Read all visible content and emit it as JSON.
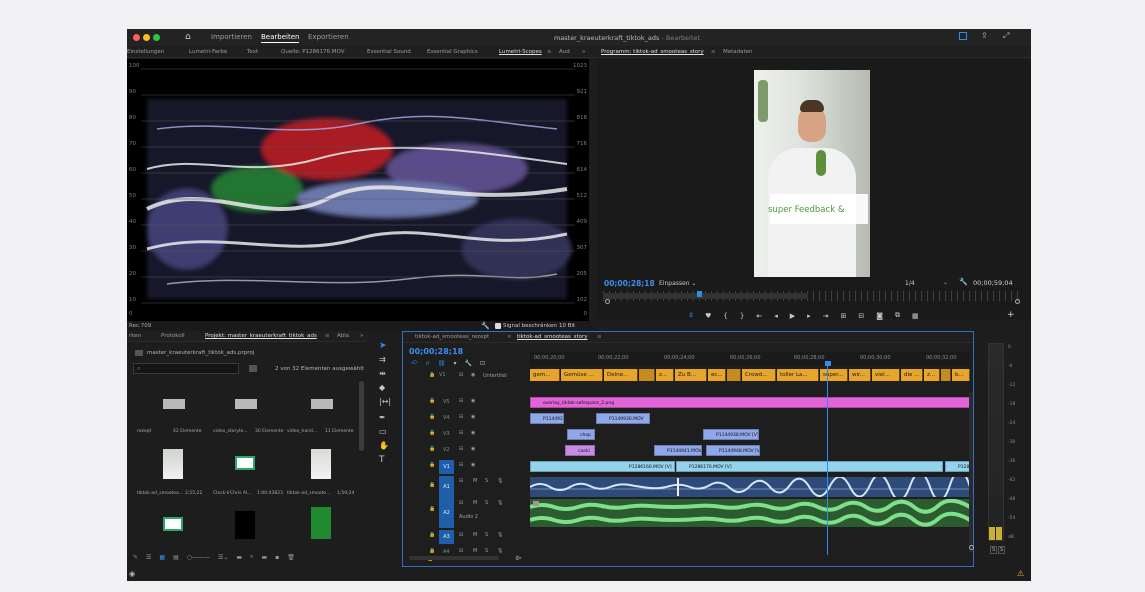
{
  "window": {
    "title": "master_kraeuterkraft_tiktok_ads",
    "title_suffix": " - Bearbeitet",
    "nav": [
      "Importieren",
      "Bearbeiten",
      "Exportieren"
    ]
  },
  "panel_tabs": [
    "Einstellungen",
    "Lumetri-Farbe",
    "Text",
    "Quelle: P1286176.MOV",
    "Essential Sound",
    "Essential Graphics",
    "Lumetri-Scopes",
    "Aud"
  ],
  "scopes": {
    "left_scale": [
      "100",
      "90",
      "80",
      "70",
      "60",
      "50",
      "40",
      "30",
      "20",
      "10",
      "0"
    ],
    "right_scale": [
      "1023",
      "921",
      "818",
      "716",
      "614",
      "512",
      "409",
      "307",
      "205",
      "102",
      "0"
    ],
    "colorspace": "Rec.709",
    "signal_label": "Signal beschränken",
    "bit_depth": "10 Bit"
  },
  "program": {
    "tabs": [
      "Programm: tiktok-ad_smooteas_story",
      "Metadaten"
    ],
    "timecode": "00;00;28;18",
    "fit": "Einpassen",
    "resolution": "1/4",
    "duration": "00;00;59;04",
    "caption": "super Feedback &"
  },
  "project": {
    "tabs": [
      "rken",
      "Protokoll",
      "Projekt: master_kraeuterkraft_tiktok_ads",
      "Abla"
    ],
    "file": "master_kraeuterkraft_tiktok_ads.prproj",
    "selection": "2 von 32 Elementen ausgewählt",
    "items": [
      {
        "name": "rezept",
        "meta": "42 Elemente"
      },
      {
        "name": "video_storyte...",
        "meta": "30 Elemente"
      },
      {
        "name": "video_hand...",
        "meta": "11 Elemente"
      },
      {
        "name": "tiktok-ad_smootea...",
        "meta": "2;55;22"
      },
      {
        "name": "Clock-IrChris Al...",
        "meta": "1:00:43823"
      },
      {
        "name": "tiktok-ad_smoote...",
        "meta": "1;59;24"
      }
    ]
  },
  "timeline": {
    "tabs": [
      "tiktok-ad_smooteas_rezept",
      "tiktok-ad_smooteas_story"
    ],
    "timecode": "00;00;28;18",
    "ruler": [
      "00;00;20;00",
      "00;00;22;00",
      "00;00;24;00",
      "00;00;26;00",
      "00;00;28;00",
      "00;00;30;00",
      "00;00;32;00"
    ],
    "subtitle_label": "Untertitel",
    "subtitles": [
      "gem...",
      "Gemüse ...",
      "Deine...",
      "z...",
      "Zu B...",
      "ec...",
      "Crowd...",
      "toller La...",
      "super...",
      "wir...",
      "viel...",
      "die ...",
      "z...",
      "b..."
    ],
    "tracks": [
      "V5",
      "V4",
      "V3",
      "V2",
      "V1",
      "A1",
      "A2",
      "A3",
      "A4"
    ],
    "audio2_label": "Audio 2",
    "mix_label": "Mix",
    "mix_value": "0,0",
    "clips": {
      "v5": "overlay_tiktok-safespace_2.png",
      "v4a": "P114492",
      "v4b": "P1149936.MOV",
      "v3a": "chop",
      "v3b": "P1144938.MOV [V]",
      "v2a": "cooki",
      "v2b": "P1144941.MOV",
      "v2c": "P1144948.MOV [V]",
      "v1a": "P1286166.MOV [V]",
      "v1b": "P1286176.MOV [V]",
      "v1c": "P128"
    }
  },
  "meter": {
    "scale": [
      "0",
      "-6",
      "-12",
      "-18",
      "-24",
      "-30",
      "-36",
      "-42",
      "-48",
      "-54",
      "dB"
    ],
    "solo": "S",
    "solo2": "S"
  },
  "colors": {
    "accent": "#2d8cf0",
    "subtitle": "#e8a52c",
    "overlay": "#e264d8",
    "video": "#8fa8ea",
    "v1": "#93d3ec",
    "audio": "#58c36b"
  }
}
